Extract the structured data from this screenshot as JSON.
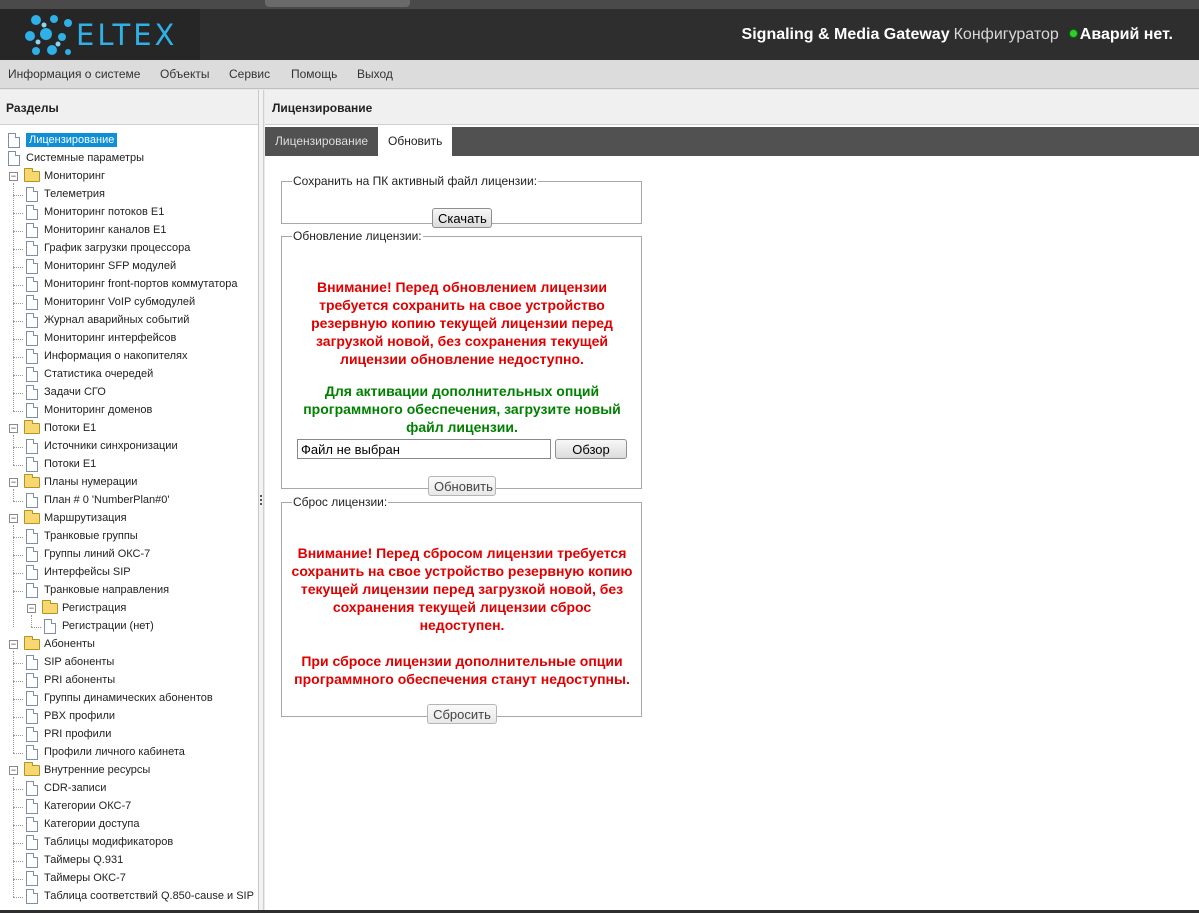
{
  "header": {
    "logo_text": "ELTEX",
    "product_name": "Signaling & Media Gateway",
    "product_suffix": "Конфигуратор",
    "alarm_status": "Аварий нет.",
    "alarm_color": "#2bd12b"
  },
  "menu": [
    "Информация о системе",
    "Объекты",
    "Сервис",
    "Помощь",
    "Выход"
  ],
  "sidebar": {
    "title": "Разделы",
    "items": [
      "Лицензирование",
      "Системные параметры",
      "Мониторинг",
      "Телеметрия",
      "Мониторинг потоков E1",
      "Мониторинг каналов E1",
      "График загрузки процессора",
      "Мониторинг SFP модулей",
      "Мониторинг front-портов коммутатора",
      "Мониторинг VoIP субмодулей",
      "Журнал аварийных событий",
      "Мониторинг интерфейсов",
      "Информация о накопителях",
      "Статистика очередей",
      "Задачи СГО",
      "Мониторинг доменов",
      "Потоки E1",
      "Источники синхронизации",
      "Потоки E1",
      "Планы нумерации",
      "План # 0 'NumberPlan#0'",
      "Маршрутизация",
      "Транковые группы",
      "Группы линий ОКС-7",
      "Интерфейсы SIP",
      "Транковые направления",
      "Регистрация",
      "Регистрации (нет)",
      "Абоненты",
      "SIP абоненты",
      "PRI абоненты",
      "Группы динамических абонентов",
      "PBX профили",
      "PRI профили",
      "Профили личного кабинета",
      "Внутренние ресурсы",
      "CDR-записи",
      "Категории ОКС-7",
      "Категории доступа",
      "Таблицы модификаторов",
      "Таймеры Q.931",
      "Таймеры ОКС-7",
      "Таблица соответствий Q.850-cause и SIP"
    ]
  },
  "content": {
    "title": "Лицензирование",
    "tabs": [
      "Лицензирование",
      "Обновить"
    ],
    "save_section": {
      "legend": "Сохранить на ПК активный файл лицензии:",
      "button": "Скачать"
    },
    "update_section": {
      "legend": "Обновление лицензии:",
      "warning": "Внимание! Перед обновлением лицензии требуется сохранить на свое устройство резервную копию текущей лицензии перед загрузкой новой, без сохранения текущей лицензии обновление недоступно.",
      "info": "Для активации дополнительных опций программного обеспечения, загрузите новый файл лицензии.",
      "file_value": "Файл не выбран",
      "browse_button": "Обзор",
      "update_button": "Обновить"
    },
    "reset_section": {
      "legend": "Сброс лицензии:",
      "warning": "Внимание! Перед сбросом лицензии требуется сохранить на свое устройство резервную копию текущей лицензии перед загрузкой новой, без сохранения текущей лицензии сброс недоступен.",
      "note": "При сбросе лицензии дополнительные опции программного обеспечения станут недоступны.",
      "reset_button": "Сбросить"
    }
  }
}
